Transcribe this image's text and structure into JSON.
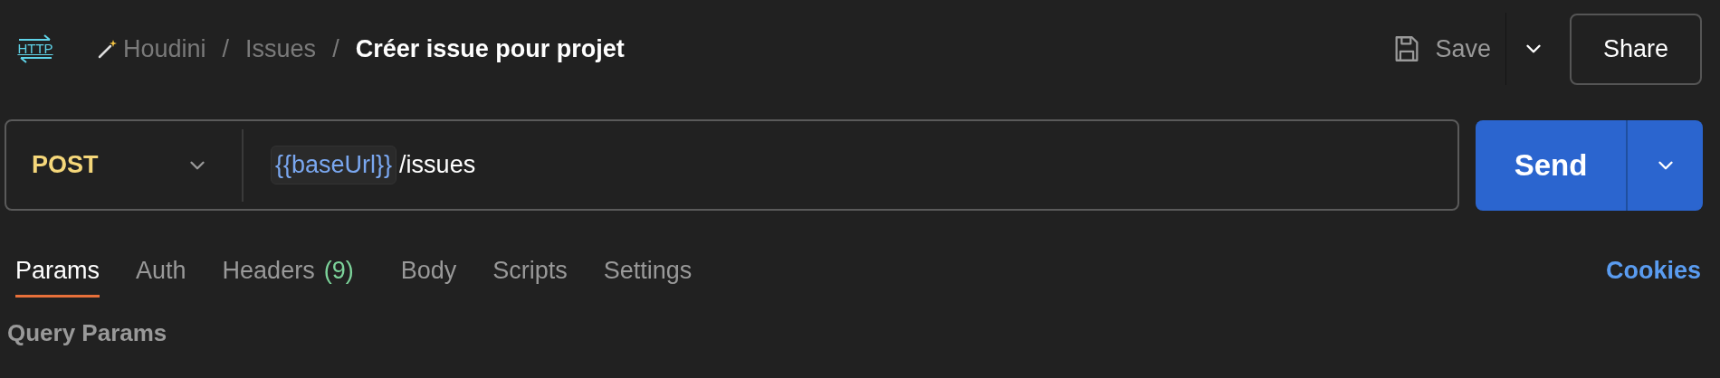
{
  "header": {
    "protocol_badge": "HTTP",
    "breadcrumb": [
      "Houdini",
      "Issues"
    ],
    "separator": "/",
    "title": "Créer issue pour projet",
    "save_label": "Save",
    "share_label": "Share"
  },
  "request": {
    "method": "POST",
    "variable": "{{baseUrl}}",
    "path": "/issues",
    "send_label": "Send"
  },
  "tabs": [
    {
      "label": "Params",
      "selected": true
    },
    {
      "label": "Auth",
      "selected": false
    },
    {
      "label": "Headers",
      "count": "(9)",
      "selected": false
    },
    {
      "label": "Body",
      "selected": false
    },
    {
      "label": "Scripts",
      "selected": false
    },
    {
      "label": "Settings",
      "selected": false
    }
  ],
  "cookies_link": "Cookies",
  "section_title": "Query Params"
}
